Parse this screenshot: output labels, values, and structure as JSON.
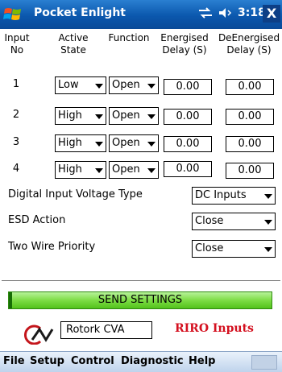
{
  "title_bar": {
    "app_title": "Pocket Enlight",
    "time": "3:18",
    "close_label": "X"
  },
  "headers": {
    "input_no": [
      "Input",
      "No"
    ],
    "active_state": [
      "Active",
      "State"
    ],
    "function": "Function",
    "energised_delay": [
      "Energised",
      "Delay (S)"
    ],
    "deenergised_delay": [
      "DeEnergised",
      "Delay (S)"
    ]
  },
  "inputs": [
    {
      "no": "1",
      "active_state": "Low",
      "function": "Open",
      "energised_delay": "0.00",
      "deenergised_delay": "0.00"
    },
    {
      "no": "2",
      "active_state": "High",
      "function": "Open",
      "energised_delay": "0.00",
      "deenergised_delay": "0.00"
    },
    {
      "no": "3",
      "active_state": "High",
      "function": "Open",
      "energised_delay": "0.00",
      "deenergised_delay": "0.00"
    },
    {
      "no": "4",
      "active_state": "High",
      "function": "Open",
      "energised_delay": "0.00",
      "deenergised_delay": "0.00"
    }
  ],
  "settings": {
    "voltage_type_label": "Digital Input Voltage Type",
    "voltage_type_value": "DC Inputs",
    "esd_action_label": "ESD Action",
    "esd_action_value": "Close",
    "two_wire_label": "Two Wire Priority",
    "two_wire_value": "Close"
  },
  "send_button": "SEND SETTINGS",
  "footer": {
    "device": "Rotork CVA",
    "mode": "RIRO Inputs"
  },
  "menu": [
    "File",
    "Setup",
    "Control",
    "Diagnostic",
    "Help"
  ],
  "colors": {
    "title_bar": "#0b57ad",
    "send_button": "#6fd13a",
    "mode_text": "#d4101f"
  }
}
